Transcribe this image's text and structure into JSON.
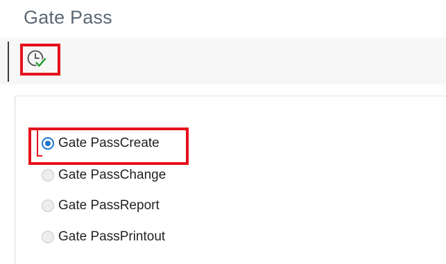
{
  "window": {
    "title": "Gate Pass"
  },
  "toolbar": {
    "execute_icon": "execute-clock-check-icon"
  },
  "options": [
    {
      "label": "Gate PassCreate",
      "selected": true
    },
    {
      "label": "Gate PassChange",
      "selected": false
    },
    {
      "label": "Gate PassReport",
      "selected": false
    },
    {
      "label": "Gate PassPrintout",
      "selected": false
    }
  ],
  "colors": {
    "title": "#5b6774",
    "accent": "#1a73c9",
    "annotation": "#e5101a",
    "check": "#2e9e3e"
  }
}
